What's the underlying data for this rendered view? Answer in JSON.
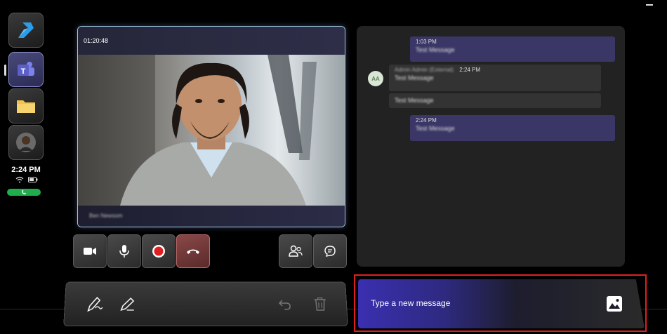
{
  "rail": {
    "apps": [
      {
        "name": "azure-app",
        "color": "#2c9ce8"
      },
      {
        "name": "teams-app",
        "color": "#5b5fc7"
      },
      {
        "name": "files-app",
        "color": "#f2c14e"
      },
      {
        "name": "contact-app",
        "color": "#888888"
      }
    ],
    "time": "2:24 PM",
    "call_color": "#1fae4b"
  },
  "video": {
    "timer": "01:20:48",
    "participant_name": "Ben Newsom"
  },
  "controls": [
    "camera-icon",
    "mic-icon",
    "record-icon",
    "hangup-icon",
    "participants-icon",
    "chat-icon"
  ],
  "ink": [
    "pen-write-icon",
    "pencil-icon",
    "undo-icon",
    "trash-icon"
  ],
  "chat": {
    "messages": [
      {
        "time": "1:03 PM",
        "text": "Test Message"
      },
      {
        "avatar": "AA",
        "sender": "Admin Admin (External)",
        "time": "2:24 PM",
        "text": "Test Message"
      },
      {
        "text": "Test Message"
      },
      {
        "time": "2:24 PM",
        "text": "Test Message"
      }
    ]
  },
  "compose": {
    "placeholder": "Type a new message"
  },
  "colors": {
    "accent": "#5b5fc7",
    "outgoing_bubble": "#3a3766",
    "highlight": "#e02020",
    "hangup": "#e05050"
  }
}
